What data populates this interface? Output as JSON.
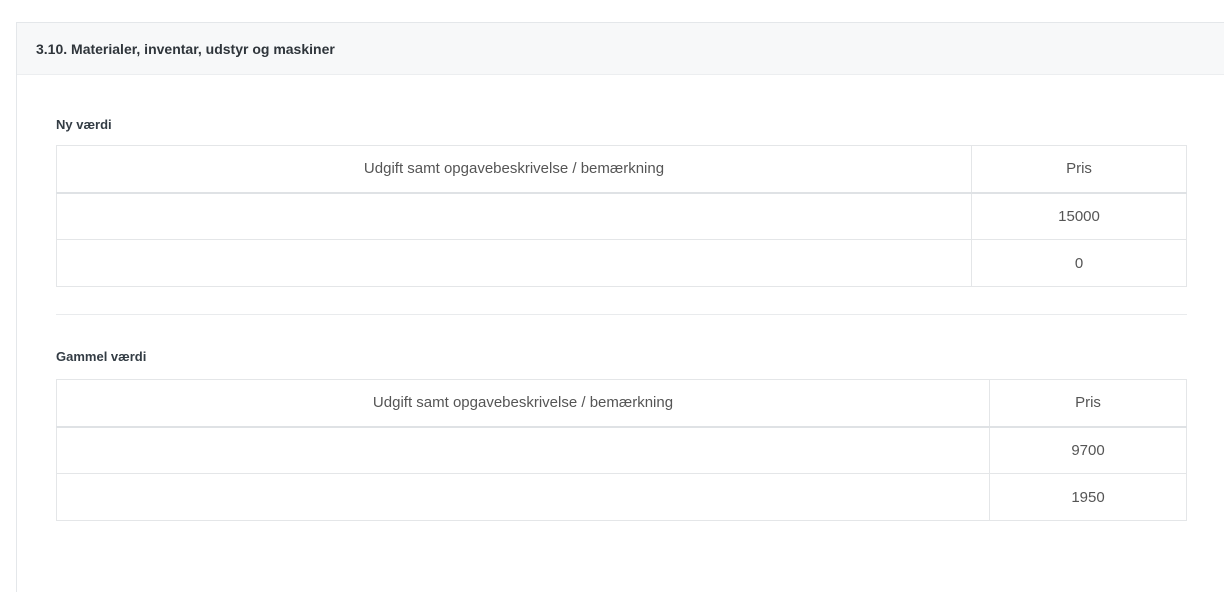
{
  "panel": {
    "title": "3.10. Materialer, inventar, udstyr og maskiner"
  },
  "new_value": {
    "title": "Ny værdi",
    "headers": {
      "description": "Udgift samt opgavebeskrivelse / bemærkning",
      "price": "Pris"
    },
    "rows": [
      {
        "description": "",
        "price": "15000"
      },
      {
        "description": "",
        "price": "0"
      }
    ]
  },
  "old_value": {
    "title": "Gammel værdi",
    "headers": {
      "description": "Udgift samt opgavebeskrivelse / bemærkning",
      "price": "Pris"
    },
    "rows": [
      {
        "description": "",
        "price": "9700"
      },
      {
        "description": "",
        "price": "1950"
      }
    ]
  }
}
